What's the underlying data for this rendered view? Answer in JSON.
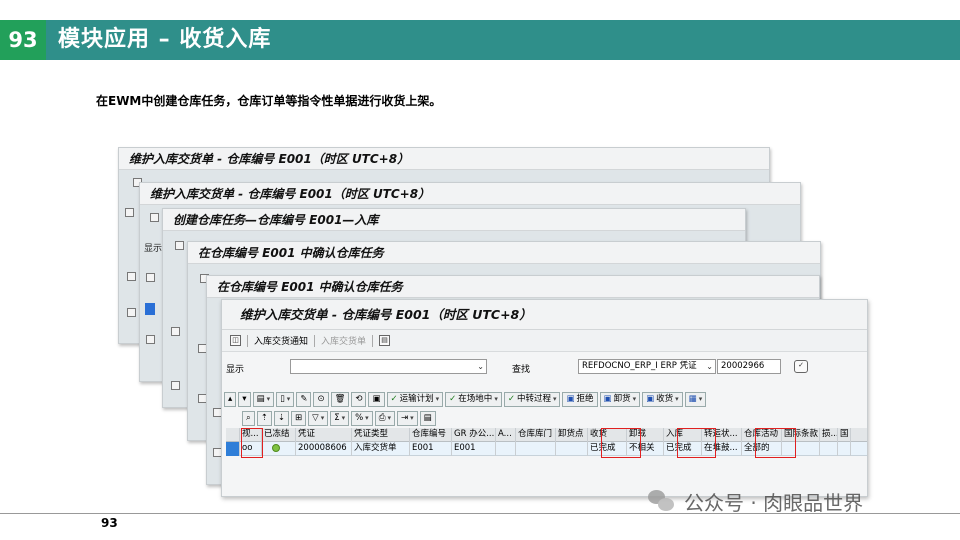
{
  "header": {
    "number": "93",
    "title": "模块应用 – 收货入库"
  },
  "subtitle": "在EWM中创建仓库任务，仓库订单等指令性单据进行收货上架。",
  "footer": {
    "page": "93"
  },
  "watermark": {
    "text": "公众号 · 肉眼品世界"
  },
  "windows": [
    {
      "title": "维护入库交货单 - 仓库编号 E001（时区 UTC+8）"
    },
    {
      "title": "维护入库交货单 - 仓库编号 E001（时区 UTC+8）"
    },
    {
      "title": "创建仓库任务—仓库编号 E001—入库"
    },
    {
      "title": "在仓库编号 E001 中确认仓库任务"
    },
    {
      "title": "在仓库编号 E001 中确认仓库任务"
    }
  ],
  "bg_fragments": {
    "show1": "显示",
    "show2": "显示"
  },
  "main": {
    "title": "维护入库交货单 - 仓库编号 E001（时区 UTC+8）",
    "menu": {
      "notify": "入库交货通知",
      "delivery": "入库交货单"
    },
    "filter": {
      "show_label": "显示",
      "show_value": "",
      "find_label": "查找",
      "find_type": "REFDOCNO_ERP_I ERP 凭证",
      "find_value": "20002966"
    },
    "toolbar1": {
      "transport_plan": "运输计划",
      "in_yard": "在场地中",
      "transit_process": "中转过程",
      "reject": "拒绝",
      "unload": "卸货",
      "receive": "收货"
    },
    "grid": {
      "columns": [
        "",
        "视...",
        "已冻结",
        "凭证",
        "凭证类型",
        "仓库编号",
        "GR 办公...",
        "A...",
        "仓库库门",
        "卸货点",
        "收货",
        "卸载",
        "入库",
        "转运状...",
        "仓库活动",
        "国际条款",
        "损...",
        "国"
      ],
      "row": [
        "",
        "",
        "",
        "200008606",
        "入库交货单",
        "E001",
        "E001",
        "",
        "",
        "",
        "已完成",
        "不相关",
        "已完成",
        "在堆鼓...",
        "全部的",
        "",
        "",
        ""
      ]
    }
  }
}
